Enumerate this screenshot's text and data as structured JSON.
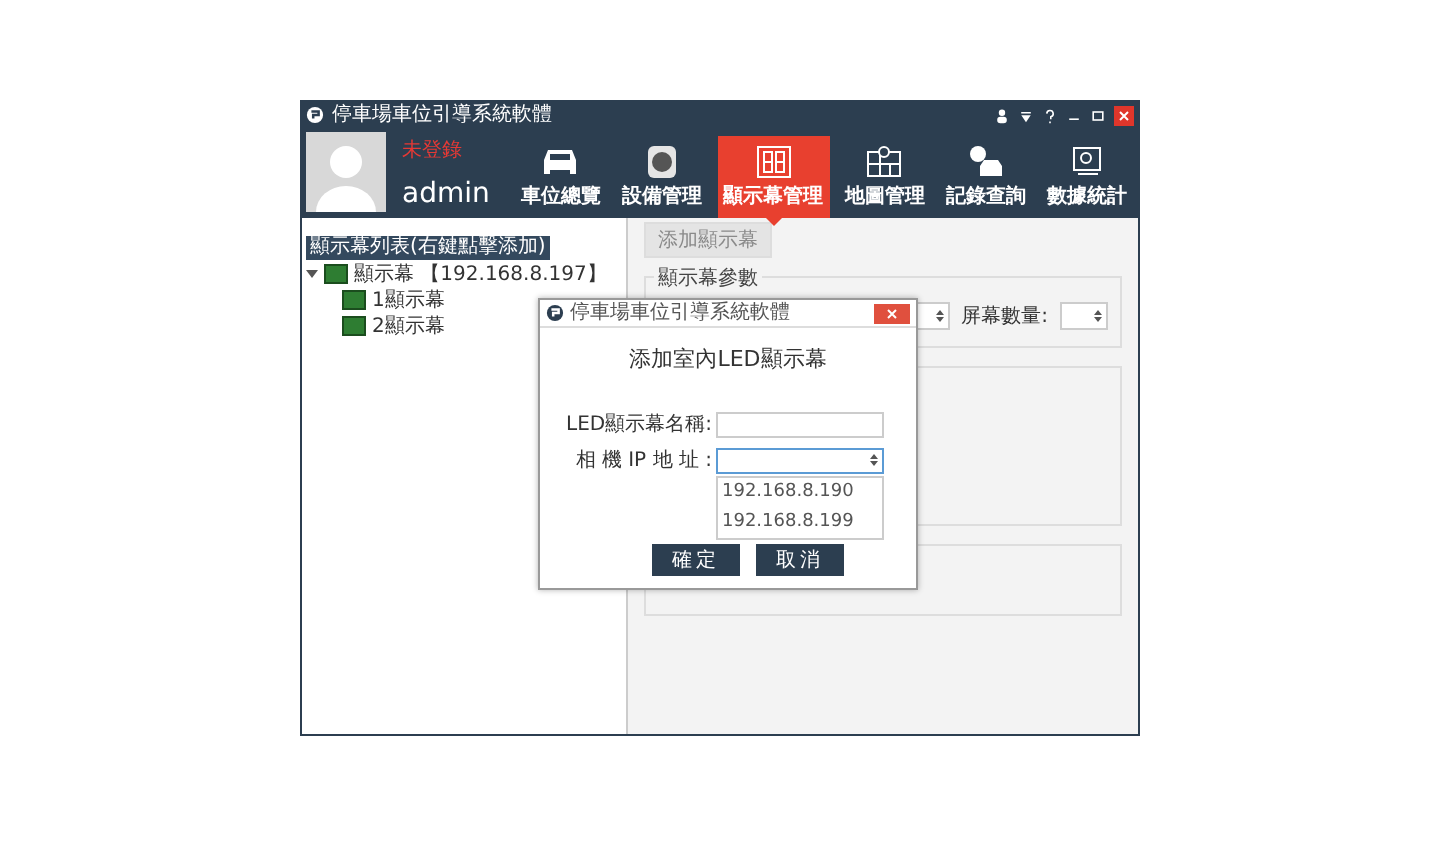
{
  "window": {
    "title": "停車場車位引導系統軟體"
  },
  "user": {
    "status": "未登錄",
    "name": "admin"
  },
  "nav": [
    {
      "kind": "car",
      "label": "車位總覽",
      "selected": false
    },
    {
      "kind": "camera",
      "label": "設備管理",
      "selected": false
    },
    {
      "kind": "display",
      "label": "顯示幕管理",
      "selected": true
    },
    {
      "kind": "map",
      "label": "地圖管理",
      "selected": false
    },
    {
      "kind": "parking",
      "label": "記錄查詢",
      "selected": false
    },
    {
      "kind": "stats",
      "label": "數據統計",
      "selected": false
    }
  ],
  "sidebar": {
    "header": "顯示幕列表(右鍵點擊添加)",
    "tree": [
      {
        "label": "顯示幕",
        "ip": "【192.168.8.197】",
        "expanded": true,
        "children": [
          {
            "label": "1顯示幕"
          },
          {
            "label": "2顯示幕"
          }
        ]
      }
    ]
  },
  "panel": {
    "button": {
      "label": "添加顯示幕",
      "disabled": true
    },
    "group_title": "顯示幕參數",
    "screen_count_label": "屏幕數量:"
  },
  "dialog": {
    "title": "停車場車位引導系統軟體",
    "heading": "添加室內LED顯示幕",
    "fields": [
      {
        "kind": "text",
        "label": "LED顯示幕名稱:"
      },
      {
        "kind": "select",
        "label": "相 機 IP 地 址 :",
        "expanded": true,
        "options": [
          "192.168.8.190",
          "192.168.8.199"
        ]
      }
    ],
    "buttons": [
      "確定",
      "取消"
    ]
  }
}
